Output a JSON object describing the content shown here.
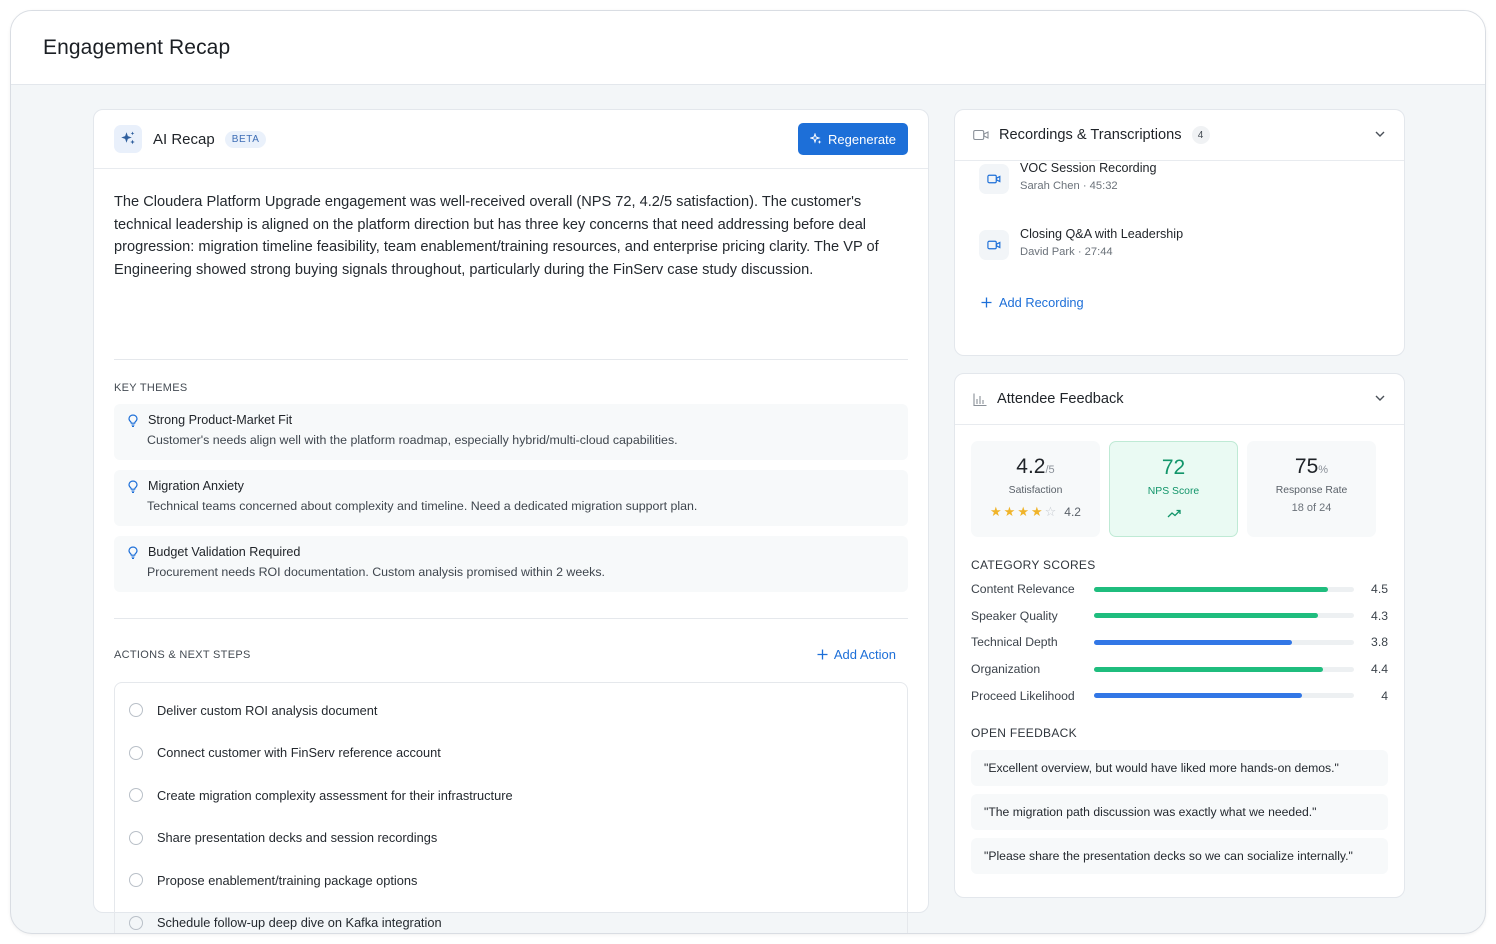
{
  "header": {
    "title": "Engagement Recap"
  },
  "recap": {
    "title": "AI Recap",
    "badge": "BETA",
    "regenerate_label": "Regenerate",
    "summary": "The Cloudera Platform Upgrade engagement was well-received overall (NPS 72, 4.2/5 satisfaction). The customer's technical leadership is aligned on the platform direction but has three key concerns that need addressing before deal progression: migration timeline feasibility, team enablement/training resources, and enterprise pricing clarity. The VP of Engineering showed strong buying signals throughout, particularly during the FinServ case study discussion.",
    "themes_label": "KEY THEMES",
    "themes": [
      {
        "title": "Strong Product-Market Fit",
        "desc": "Customer's needs align well with the platform roadmap, especially hybrid/multi-cloud capabilities."
      },
      {
        "title": "Migration Anxiety",
        "desc": "Technical teams concerned about complexity and timeline. Need a dedicated migration support plan."
      },
      {
        "title": "Budget Validation Required",
        "desc": "Procurement needs ROI documentation. Custom analysis promised within 2 weeks."
      }
    ],
    "actions_label": "ACTIONS & NEXT STEPS",
    "add_action_label": "Add Action",
    "actions": [
      "Deliver custom ROI analysis document",
      "Connect customer with FinServ reference account",
      "Create migration complexity assessment for their infrastructure",
      "Share presentation decks and session recordings",
      "Propose enablement/training package options",
      "Schedule follow-up deep dive on Kafka integration"
    ]
  },
  "recordings": {
    "title": "Recordings & Transcriptions",
    "count": "4",
    "items": [
      {
        "name": "VOC Session Recording",
        "meta": "Sarah Chen · 45:32"
      },
      {
        "name": "Closing Q&A with Leadership",
        "meta": "David Park · 27:44"
      }
    ],
    "add_label": "Add Recording"
  },
  "feedback": {
    "title": "Attendee Feedback",
    "satisfaction": {
      "value": "4.2",
      "suffix": "/5",
      "label": "Satisfaction",
      "rating_text": "4.2",
      "stars_filled": 4,
      "stars_total": 5
    },
    "nps": {
      "value": "72",
      "label": "NPS Score"
    },
    "response": {
      "value": "75",
      "suffix": "%",
      "label": "Response Rate",
      "detail": "18 of 24"
    },
    "category_label": "CATEGORY SCORES",
    "categories": [
      {
        "name": "Content Relevance",
        "value": "4.5",
        "score": 4.5,
        "color": "#1fbd7e"
      },
      {
        "name": "Speaker Quality",
        "value": "4.3",
        "score": 4.3,
        "color": "#1fbd7e"
      },
      {
        "name": "Technical Depth",
        "value": "3.8",
        "score": 3.8,
        "color": "#3277e6"
      },
      {
        "name": "Organization",
        "value": "4.4",
        "score": 4.4,
        "color": "#1fbd7e"
      },
      {
        "name": "Proceed Likelihood",
        "value": "4",
        "score": 4.0,
        "color": "#3277e6"
      }
    ],
    "open_label": "OPEN FEEDBACK",
    "quotes": [
      "\"Excellent overview, but would have liked more hands-on demos.\"",
      "\"The migration path discussion was exactly what we needed.\"",
      "\"Please share the presentation decks so we can socialize internally.\""
    ]
  },
  "colors": {
    "accent": "#1d6fd8",
    "success": "#12956a",
    "bar_green": "#1fbd7e",
    "bar_blue": "#3277e6",
    "star": "#f0b42a"
  }
}
